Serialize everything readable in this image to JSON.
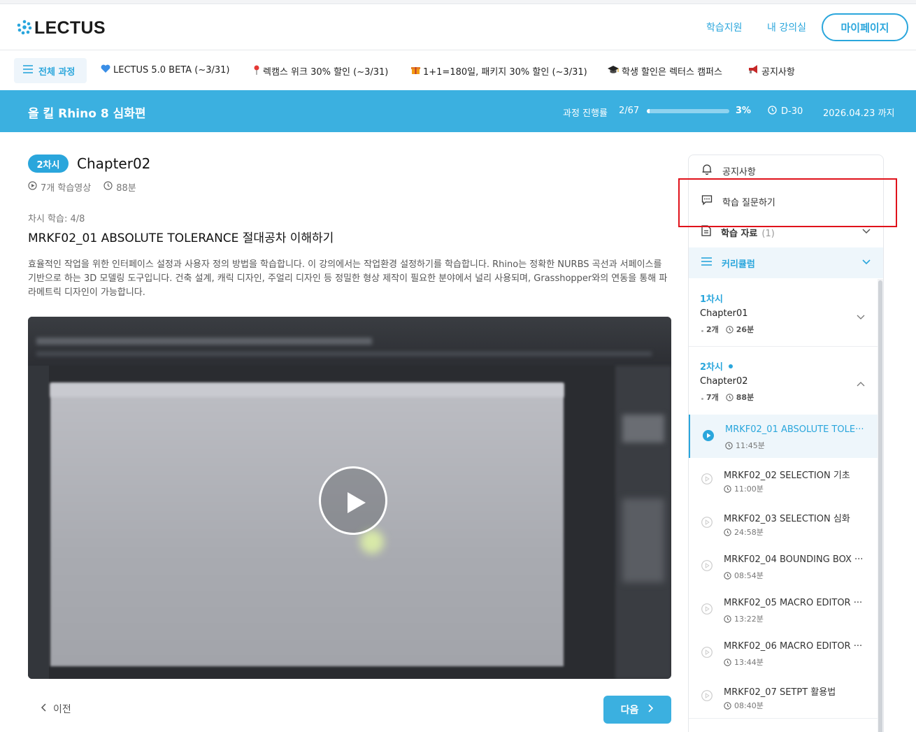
{
  "header": {
    "logo": "LECTUS",
    "nav": [
      "학습지원",
      "내 강의실"
    ],
    "mypage": "마이페이지"
  },
  "navbar": {
    "all_courses": "전체 과정",
    "items": [
      {
        "icon": "heart-icon",
        "label": "LECTUS 5.0 BETA (~3/31)"
      },
      {
        "icon": "pin-icon",
        "label": "렉캠스 위크 30% 할인 (~3/31)"
      },
      {
        "icon": "gift-icon",
        "label": "1+1=180일, 패키지 30% 할인 (~3/31)"
      },
      {
        "icon": "graduation-cap-icon",
        "label": "학생 할인은 렉터스 캠퍼스"
      },
      {
        "icon": "megaphone-icon",
        "label": "공지사항"
      }
    ]
  },
  "banner": {
    "title": "올 킬 Rhino 8 심화편",
    "progress_label": "과정 진행률",
    "progress_count": "2/67",
    "progress_fraction": 0.03,
    "progress_pct": "3%",
    "dday": "D-30",
    "until": "2026.04.23 까지"
  },
  "main": {
    "badge": "2차시",
    "chapter": "Chapter02",
    "videos": "7개 학습영상",
    "duration": "88분",
    "lesson_progress": "차시 학습: 4/8",
    "lesson_title": "MRKF02_01 ABSOLUTE TOLERANCE 절대공차 이해하기",
    "description": "효율적인 작업을 위한 인터페이스 설정과 사용자 정의 방법을 학습합니다. 이 강의에서는 작업환경 설정하기를 학습합니다. Rhino는 정확한 NURBS 곡선과 서페이스를 기반으로 하는 3D 모델링 도구입니다. 건축 설계, 캐릭 디자인, 주얼리 디자인 등 정밀한 형상 제작이 필요한 분야에서 널리 사용되며, Grasshopper와의 연동을 통해 파라메트릭 디자인이 가능합니다.",
    "prev": "이전",
    "next": "다음"
  },
  "sidebar": {
    "notice": "공지사항",
    "question": "학습 질문하기",
    "materials": "학습 자료",
    "materials_count": "(1)",
    "curriculum": "커리큘럼",
    "sessions": [
      {
        "label": "1차시",
        "title": "Chapter01",
        "count": "2개",
        "duration": "26분"
      },
      {
        "label": "2차시",
        "title": "Chapter02",
        "count": "7개",
        "duration": "88분"
      }
    ],
    "lectures": [
      {
        "title": "MRKF02_01 ABSOLUTE TOLE···",
        "time": "11:45분"
      },
      {
        "title": "MRKF02_02 SELECTION 기초",
        "time": "11:00분"
      },
      {
        "title": "MRKF02_03 SELECTION 심화",
        "time": "24:58분"
      },
      {
        "title": "MRKF02_04 BOUNDING BOX ···",
        "time": "08:54분"
      },
      {
        "title": "MRKF02_05 MACRO EDITOR ···",
        "time": "13:22분"
      },
      {
        "title": "MRKF02_06 MACRO EDITOR ···",
        "time": "13:44분"
      },
      {
        "title": "MRKF02_07 SETPT 활용법",
        "time": "08:40분"
      }
    ]
  }
}
